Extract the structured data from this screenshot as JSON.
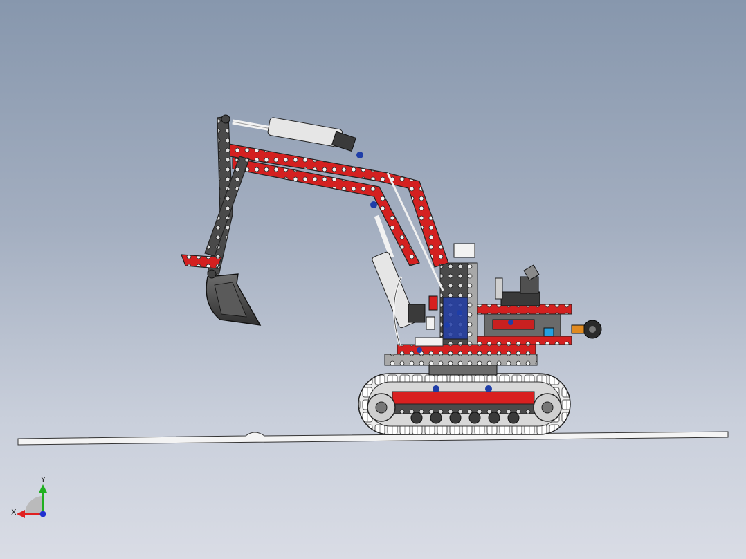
{
  "viewport": {
    "background_top": "#8797ad",
    "background_bottom": "#d9dce5"
  },
  "model": {
    "subject": "technic-excavator",
    "colors": {
      "red": "#d42020",
      "dark_gray": "#3c3c3c",
      "light_gray": "#9c9c9c",
      "white": "#f2f2f2",
      "blue": "#1f3ea8",
      "ground": "#f4f4f4"
    }
  },
  "triad": {
    "x_label": "X",
    "y_label": "Y",
    "x_color": "#e02020",
    "y_color": "#20b020",
    "z_color": "#2030d0"
  }
}
